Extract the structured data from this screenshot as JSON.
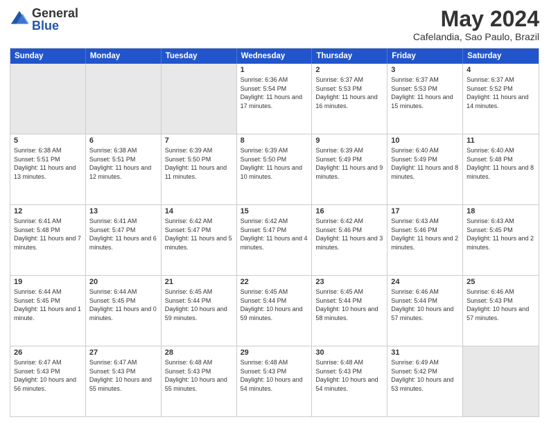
{
  "header": {
    "logo_general": "General",
    "logo_blue": "Blue",
    "title": "May 2024",
    "location": "Cafelandia, Sao Paulo, Brazil"
  },
  "days_of_week": [
    "Sunday",
    "Monday",
    "Tuesday",
    "Wednesday",
    "Thursday",
    "Friday",
    "Saturday"
  ],
  "weeks": [
    [
      {
        "day": "",
        "info": "",
        "empty": true
      },
      {
        "day": "",
        "info": "",
        "empty": true
      },
      {
        "day": "",
        "info": "",
        "empty": true
      },
      {
        "day": "1",
        "info": "Sunrise: 6:36 AM\nSunset: 5:54 PM\nDaylight: 11 hours and 17 minutes.",
        "empty": false
      },
      {
        "day": "2",
        "info": "Sunrise: 6:37 AM\nSunset: 5:53 PM\nDaylight: 11 hours and 16 minutes.",
        "empty": false
      },
      {
        "day": "3",
        "info": "Sunrise: 6:37 AM\nSunset: 5:53 PM\nDaylight: 11 hours and 15 minutes.",
        "empty": false
      },
      {
        "day": "4",
        "info": "Sunrise: 6:37 AM\nSunset: 5:52 PM\nDaylight: 11 hours and 14 minutes.",
        "empty": false
      }
    ],
    [
      {
        "day": "5",
        "info": "Sunrise: 6:38 AM\nSunset: 5:51 PM\nDaylight: 11 hours and 13 minutes.",
        "empty": false
      },
      {
        "day": "6",
        "info": "Sunrise: 6:38 AM\nSunset: 5:51 PM\nDaylight: 11 hours and 12 minutes.",
        "empty": false
      },
      {
        "day": "7",
        "info": "Sunrise: 6:39 AM\nSunset: 5:50 PM\nDaylight: 11 hours and 11 minutes.",
        "empty": false
      },
      {
        "day": "8",
        "info": "Sunrise: 6:39 AM\nSunset: 5:50 PM\nDaylight: 11 hours and 10 minutes.",
        "empty": false
      },
      {
        "day": "9",
        "info": "Sunrise: 6:39 AM\nSunset: 5:49 PM\nDaylight: 11 hours and 9 minutes.",
        "empty": false
      },
      {
        "day": "10",
        "info": "Sunrise: 6:40 AM\nSunset: 5:49 PM\nDaylight: 11 hours and 8 minutes.",
        "empty": false
      },
      {
        "day": "11",
        "info": "Sunrise: 6:40 AM\nSunset: 5:48 PM\nDaylight: 11 hours and 8 minutes.",
        "empty": false
      }
    ],
    [
      {
        "day": "12",
        "info": "Sunrise: 6:41 AM\nSunset: 5:48 PM\nDaylight: 11 hours and 7 minutes.",
        "empty": false
      },
      {
        "day": "13",
        "info": "Sunrise: 6:41 AM\nSunset: 5:47 PM\nDaylight: 11 hours and 6 minutes.",
        "empty": false
      },
      {
        "day": "14",
        "info": "Sunrise: 6:42 AM\nSunset: 5:47 PM\nDaylight: 11 hours and 5 minutes.",
        "empty": false
      },
      {
        "day": "15",
        "info": "Sunrise: 6:42 AM\nSunset: 5:47 PM\nDaylight: 11 hours and 4 minutes.",
        "empty": false
      },
      {
        "day": "16",
        "info": "Sunrise: 6:42 AM\nSunset: 5:46 PM\nDaylight: 11 hours and 3 minutes.",
        "empty": false
      },
      {
        "day": "17",
        "info": "Sunrise: 6:43 AM\nSunset: 5:46 PM\nDaylight: 11 hours and 2 minutes.",
        "empty": false
      },
      {
        "day": "18",
        "info": "Sunrise: 6:43 AM\nSunset: 5:45 PM\nDaylight: 11 hours and 2 minutes.",
        "empty": false
      }
    ],
    [
      {
        "day": "19",
        "info": "Sunrise: 6:44 AM\nSunset: 5:45 PM\nDaylight: 11 hours and 1 minute.",
        "empty": false
      },
      {
        "day": "20",
        "info": "Sunrise: 6:44 AM\nSunset: 5:45 PM\nDaylight: 11 hours and 0 minutes.",
        "empty": false
      },
      {
        "day": "21",
        "info": "Sunrise: 6:45 AM\nSunset: 5:44 PM\nDaylight: 10 hours and 59 minutes.",
        "empty": false
      },
      {
        "day": "22",
        "info": "Sunrise: 6:45 AM\nSunset: 5:44 PM\nDaylight: 10 hours and 59 minutes.",
        "empty": false
      },
      {
        "day": "23",
        "info": "Sunrise: 6:45 AM\nSunset: 5:44 PM\nDaylight: 10 hours and 58 minutes.",
        "empty": false
      },
      {
        "day": "24",
        "info": "Sunrise: 6:46 AM\nSunset: 5:44 PM\nDaylight: 10 hours and 57 minutes.",
        "empty": false
      },
      {
        "day": "25",
        "info": "Sunrise: 6:46 AM\nSunset: 5:43 PM\nDaylight: 10 hours and 57 minutes.",
        "empty": false
      }
    ],
    [
      {
        "day": "26",
        "info": "Sunrise: 6:47 AM\nSunset: 5:43 PM\nDaylight: 10 hours and 56 minutes.",
        "empty": false
      },
      {
        "day": "27",
        "info": "Sunrise: 6:47 AM\nSunset: 5:43 PM\nDaylight: 10 hours and 55 minutes.",
        "empty": false
      },
      {
        "day": "28",
        "info": "Sunrise: 6:48 AM\nSunset: 5:43 PM\nDaylight: 10 hours and 55 minutes.",
        "empty": false
      },
      {
        "day": "29",
        "info": "Sunrise: 6:48 AM\nSunset: 5:43 PM\nDaylight: 10 hours and 54 minutes.",
        "empty": false
      },
      {
        "day": "30",
        "info": "Sunrise: 6:48 AM\nSunset: 5:43 PM\nDaylight: 10 hours and 54 minutes.",
        "empty": false
      },
      {
        "day": "31",
        "info": "Sunrise: 6:49 AM\nSunset: 5:42 PM\nDaylight: 10 hours and 53 minutes.",
        "empty": false
      },
      {
        "day": "",
        "info": "",
        "empty": true
      }
    ]
  ]
}
